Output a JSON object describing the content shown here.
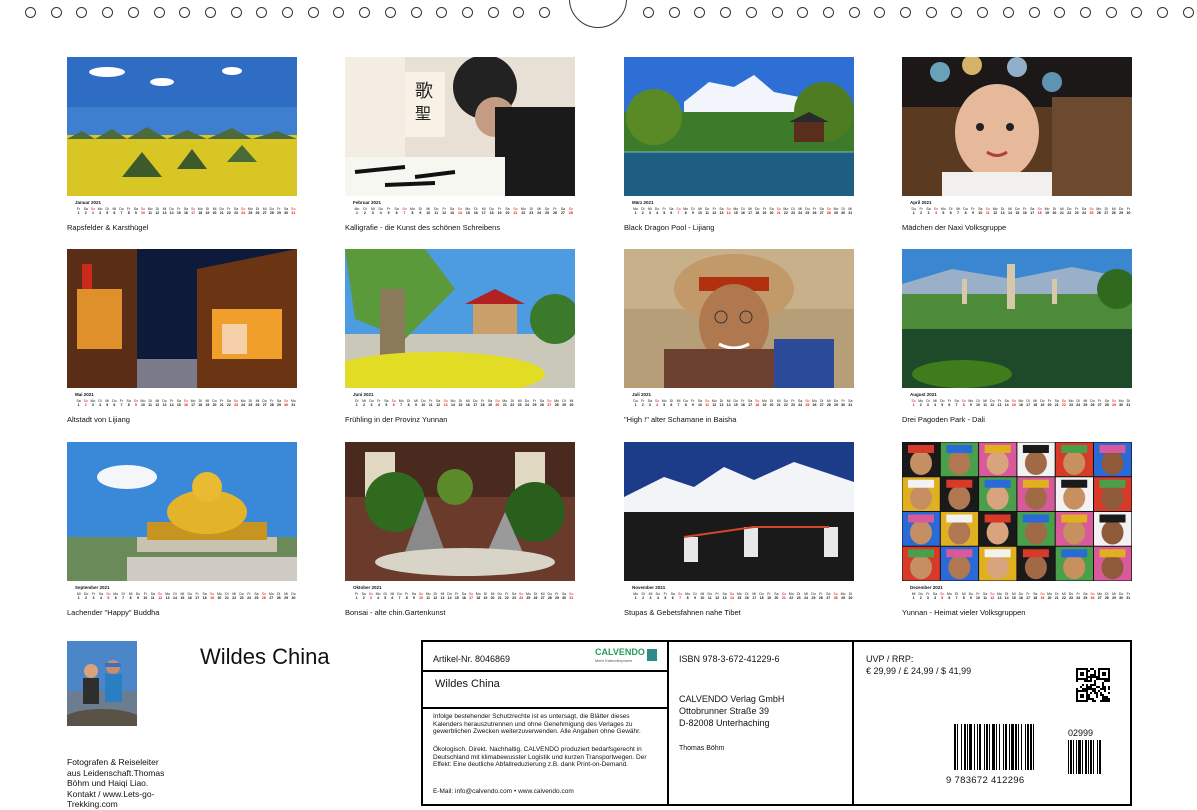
{
  "page": {
    "title": "Wildes China"
  },
  "months": [
    {
      "month": "Januar 2021",
      "caption": "Rapsfelder & Karsthügel",
      "start": 5,
      "days": 31,
      "sundays": [
        3,
        10,
        17,
        24,
        31
      ],
      "scene": "karst"
    },
    {
      "month": "Februar 2021",
      "caption": "Kalligrafie - die Kunst des schönen Schreibens",
      "start": 1,
      "days": 28,
      "sundays": [
        7,
        14,
        21,
        28
      ],
      "scene": "calligraphy"
    },
    {
      "month": "März 2021",
      "caption": "Black Dragon Pool - Lijiang",
      "start": 1,
      "days": 31,
      "sundays": [
        7,
        14,
        21,
        28
      ],
      "scene": "pool"
    },
    {
      "month": "April 2021",
      "caption": "Mädchen der Naxi Volksgruppe",
      "start": 4,
      "days": 30,
      "sundays": [
        4,
        11,
        18,
        25
      ],
      "scene": "girl"
    },
    {
      "month": "Mai 2021",
      "caption": "Altstadt von Lijiang",
      "start": 6,
      "days": 31,
      "sundays": [
        2,
        9,
        16,
        23,
        30
      ],
      "scene": "town"
    },
    {
      "month": "Juni 2021",
      "caption": "Frühling in der Provinz Yunnan",
      "start": 2,
      "days": 30,
      "sundays": [
        6,
        13,
        20,
        27
      ],
      "scene": "spring"
    },
    {
      "month": "Juli 2021",
      "caption": "\"High !\" alter Schamane in Baisha",
      "start": 4,
      "days": 31,
      "sundays": [
        4,
        11,
        18,
        25
      ],
      "scene": "shaman"
    },
    {
      "month": "August 2021",
      "caption": "Drei Pagoden Park - Dali",
      "start": 7,
      "days": 31,
      "sundays": [
        1,
        8,
        15,
        22,
        29
      ],
      "scene": "pagodas"
    },
    {
      "month": "September 2021",
      "caption": "Lachender \"Happy\" Buddha",
      "start": 3,
      "days": 30,
      "sundays": [
        5,
        12,
        19,
        26
      ],
      "scene": "buddha"
    },
    {
      "month": "Oktober 2021",
      "caption": "Bonsai - alte chin.Gartenkunst",
      "start": 5,
      "days": 31,
      "sundays": [
        3,
        10,
        17,
        24,
        31
      ],
      "scene": "bonsai"
    },
    {
      "month": "November 2021",
      "caption": "Stupas & Gebetsfahnen nahe Tibet",
      "start": 1,
      "days": 30,
      "sundays": [
        7,
        14,
        21,
        28
      ],
      "scene": "stupas"
    },
    {
      "month": "Dezember 2021",
      "caption": "Yunnan - Heimat vieler Volksgruppen",
      "start": 3,
      "days": 31,
      "sundays": [
        5,
        12,
        19,
        26
      ],
      "scene": "faces"
    }
  ],
  "weekday_letters": [
    "Mo",
    "Di",
    "Mi",
    "Do",
    "Fr",
    "Sa",
    "So"
  ],
  "author": {
    "lines": [
      "Fotografen & Reiseleiter",
      "aus Leidenschaft.Thomas",
      "Böhm und Haiqi Liao.",
      "Kontakt / www.Lets-go-",
      "Trekking.com"
    ]
  },
  "info": {
    "artikel": "Artikel-Nr. 8046869",
    "brand": "CALVENDO",
    "brand_sub": "Mehr Kalenderpower",
    "product_title": "Wildes China",
    "legal": "Infolge bestehender Schutzrechte ist es untersagt, die Blätter dieses Kalenders herauszutrennen und ohne Genehmigung des Verlages zu gewerblichen Zwecken weiterzuverwenden. Alle Angaben ohne Gewähr.",
    "eco": "Ökologisch. Direkt. Nachhaltig. CALVENDO produziert bedarfsgerecht in Deutschland mit klimabewusster Logistik und kurzen Transportwegen. Der Effekt: Eine deutliche Abfallreduzierung z.B. dank Print-on-Demand.",
    "email": "E-Mail: info@calvendo.com • www.calvendo.com",
    "isbn": "ISBN 978-3-672-41229-6",
    "publisher": [
      "CALVENDO Verlag GmbH",
      "Ottobrunner Straße 39",
      "D-82008 Unterhaching"
    ],
    "author_name": "Thomas Böhm",
    "price_label": "UVP / RRP:",
    "price": "€ 29,99 / £ 24,99 / $ 41,99",
    "barcode_addon": "02999",
    "barcode_number": "9 783672 412296"
  }
}
